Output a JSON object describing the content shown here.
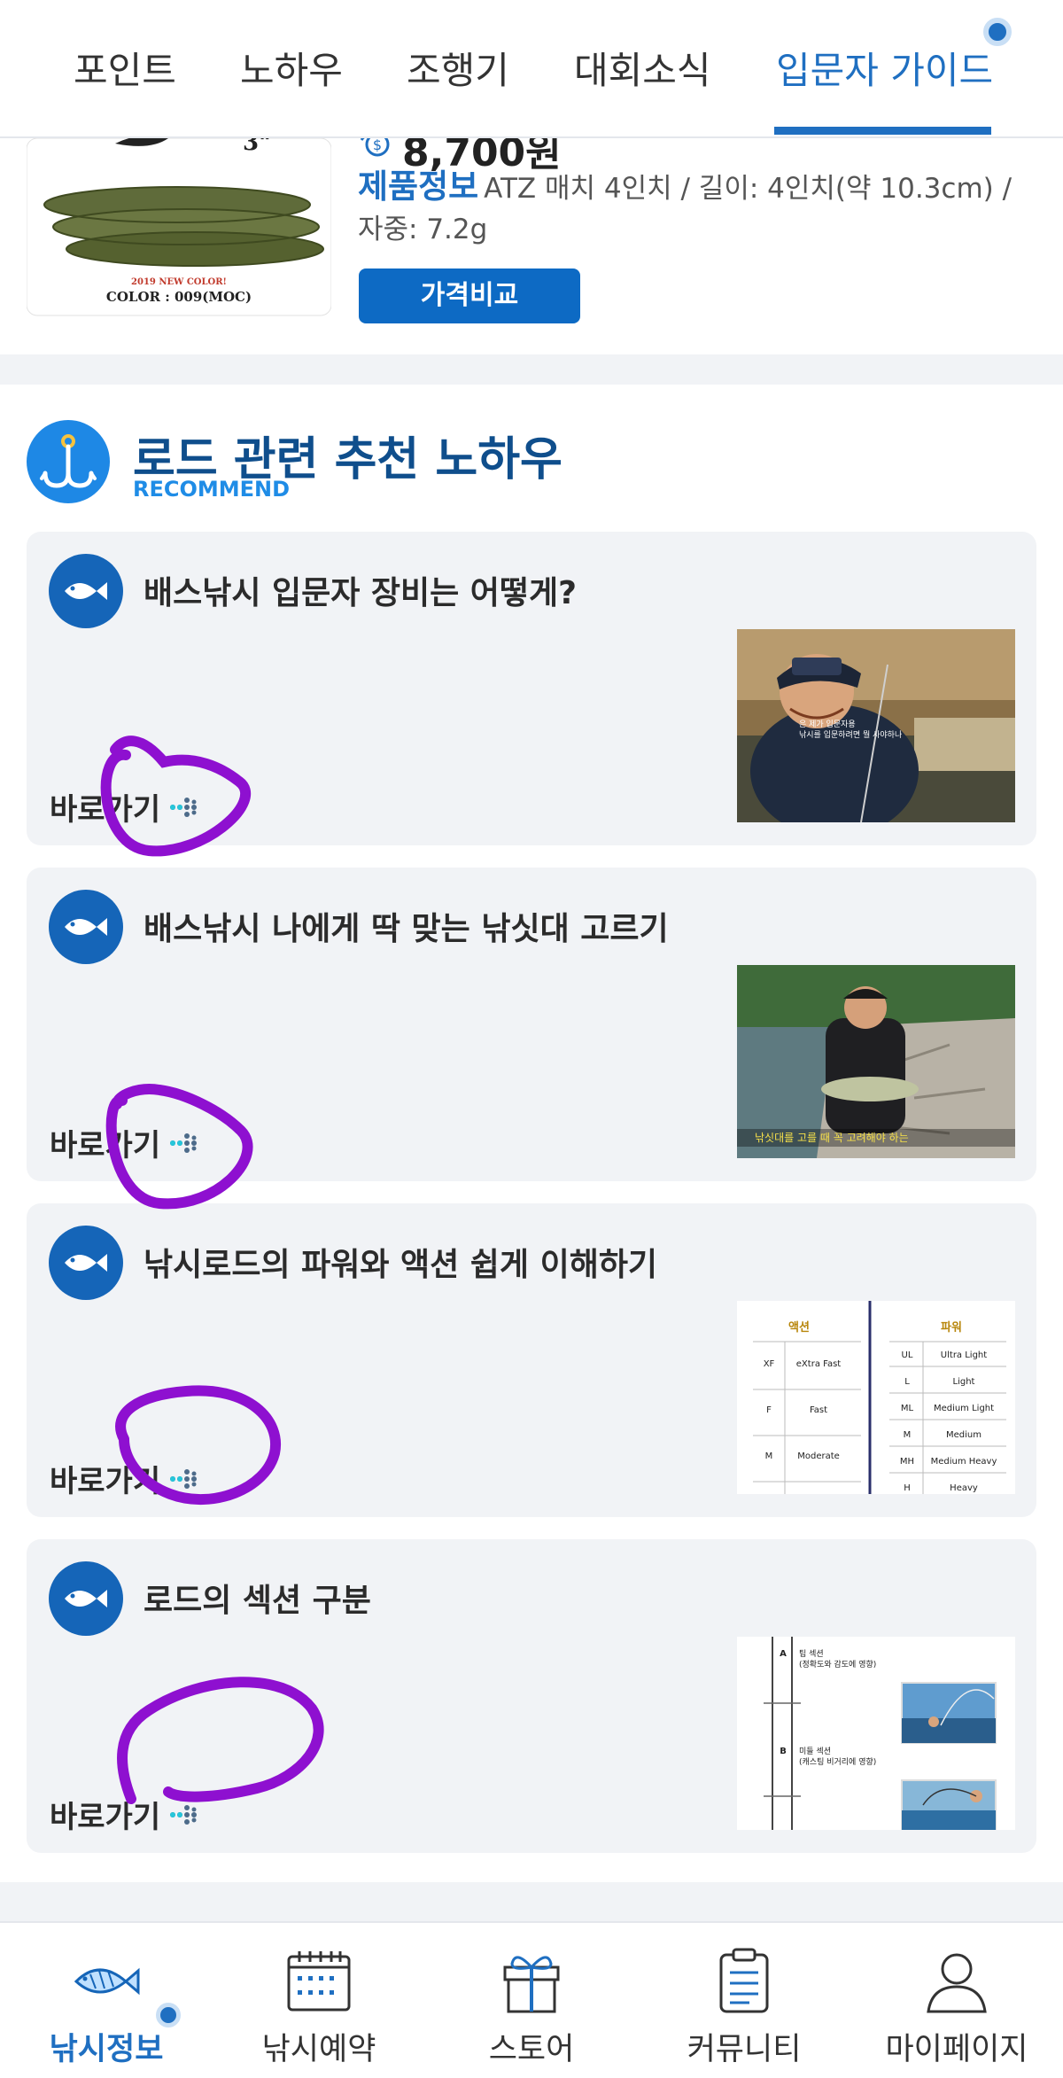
{
  "top_tabs": [
    {
      "label": "포인트"
    },
    {
      "label": "노하우"
    },
    {
      "label": "조행기"
    },
    {
      "label": "대회소식"
    },
    {
      "label": "입문자 가이드",
      "active": true
    }
  ],
  "product": {
    "price": "8,700원",
    "thumb_size_label": "3\"",
    "thumb_caption_top": "2019 NEW COLOR!",
    "thumb_caption": "COLOR : 009(MOC)",
    "info_label": "제품정보",
    "info_text": "ATZ 매치 4인치 / 길이: 4인치(약 10.3cm) / 자중: 7.2g",
    "compare_button": "가격비교"
  },
  "recommend": {
    "title": "로드 관련 추천 노하우",
    "subtitle": "RECOMMEND",
    "go_label": "바로가기",
    "cards": [
      {
        "title": "배스낚시 입문자 장비는 어떻게?",
        "thumb_icon": "angler-portrait-photo",
        "caption_1": "은 제가 입문자용",
        "caption_2": "낚시를 입문하려면 뭘 사야하나"
      },
      {
        "title": "배스낚시 나에게 딱 맞는 낚싯대 고르기",
        "thumb_icon": "angler-with-bass-photo",
        "caption_1": "낚싯대를 고를 때 꼭 고려해야 하는"
      },
      {
        "title": "낚시로드의 파워와 액션 쉽게 이해하기",
        "thumb_icon": "rod-power-action-table",
        "action_header": "액션",
        "power_header": "파워",
        "action_rows": [
          [
            "XF",
            "eXtra Fast"
          ],
          [
            "F",
            "Fast"
          ],
          [
            "M",
            "Moderate"
          ]
        ],
        "power_rows": [
          [
            "UL",
            "Ultra Light"
          ],
          [
            "L",
            "Light"
          ],
          [
            "ML",
            "Medium Light"
          ],
          [
            "M",
            "Medium"
          ],
          [
            "MH",
            "Medium Heavy"
          ],
          [
            "H",
            "Heavy"
          ]
        ]
      },
      {
        "title": "로드의 섹션 구분",
        "thumb_icon": "rod-section-diagram",
        "sec_a_letter": "A",
        "sec_a_title": "팁 섹션",
        "sec_a_desc": "(정확도와 감도에 영향)",
        "sec_b_letter": "B",
        "sec_b_title": "미들 섹션",
        "sec_b_desc": "(캐스팅 비거리에 영향)"
      }
    ]
  },
  "bottom_nav": [
    {
      "label": "낚시정보",
      "icon": "fish-icon",
      "active": true
    },
    {
      "label": "낚시예약",
      "icon": "calendar-icon"
    },
    {
      "label": "스토어",
      "icon": "gift-icon"
    },
    {
      "label": "커뮤니티",
      "icon": "clipboard-icon"
    },
    {
      "label": "마이페이지",
      "icon": "user-icon"
    }
  ],
  "colors": {
    "accent": "#1f6fc1",
    "button": "#0d6ac4",
    "title": "#0f4e8c",
    "scribble": "#8e10d0"
  }
}
